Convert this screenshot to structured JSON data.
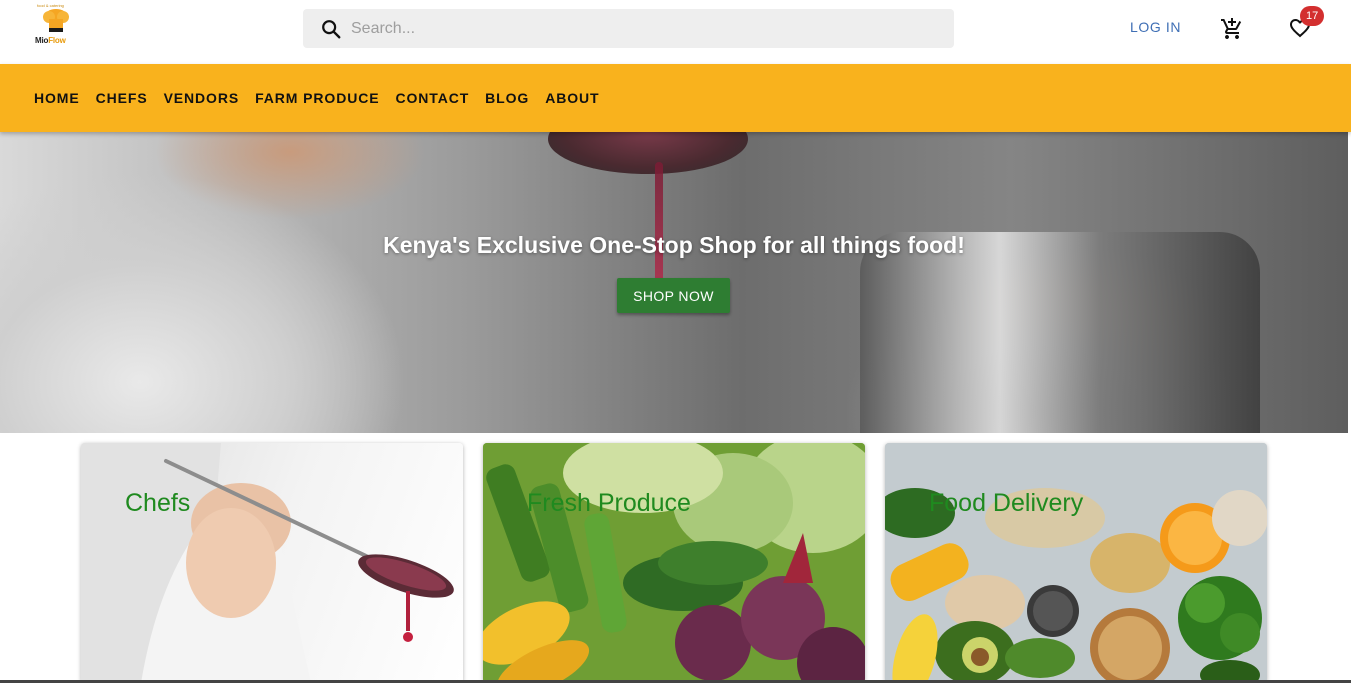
{
  "header": {
    "logo": {
      "tagline": "food & catering",
      "brand_main": "Mio",
      "brand_accent": "Flow"
    },
    "search": {
      "placeholder": "Search..."
    },
    "login_label": "LOG IN",
    "wishlist_count": "17"
  },
  "nav": {
    "items": [
      {
        "label": "HOME"
      },
      {
        "label": "CHEFS"
      },
      {
        "label": "VENDORS"
      },
      {
        "label": "FARM PRODUCE"
      },
      {
        "label": "CONTACT"
      },
      {
        "label": "BLOG"
      },
      {
        "label": "ABOUT"
      }
    ]
  },
  "hero": {
    "title": "Kenya's Exclusive One-Stop Shop for all things food!",
    "button_label": "SHOP NOW"
  },
  "cards": [
    {
      "title": "Chefs"
    },
    {
      "title": "Fresh Produce"
    },
    {
      "title": "Food Delivery"
    }
  ],
  "colors": {
    "nav_background": "#f9b21d",
    "login_link": "#3f6fb5",
    "badge": "#d32f2f",
    "shop_button": "#2e7d32",
    "card_title": "#1f8a1f"
  }
}
